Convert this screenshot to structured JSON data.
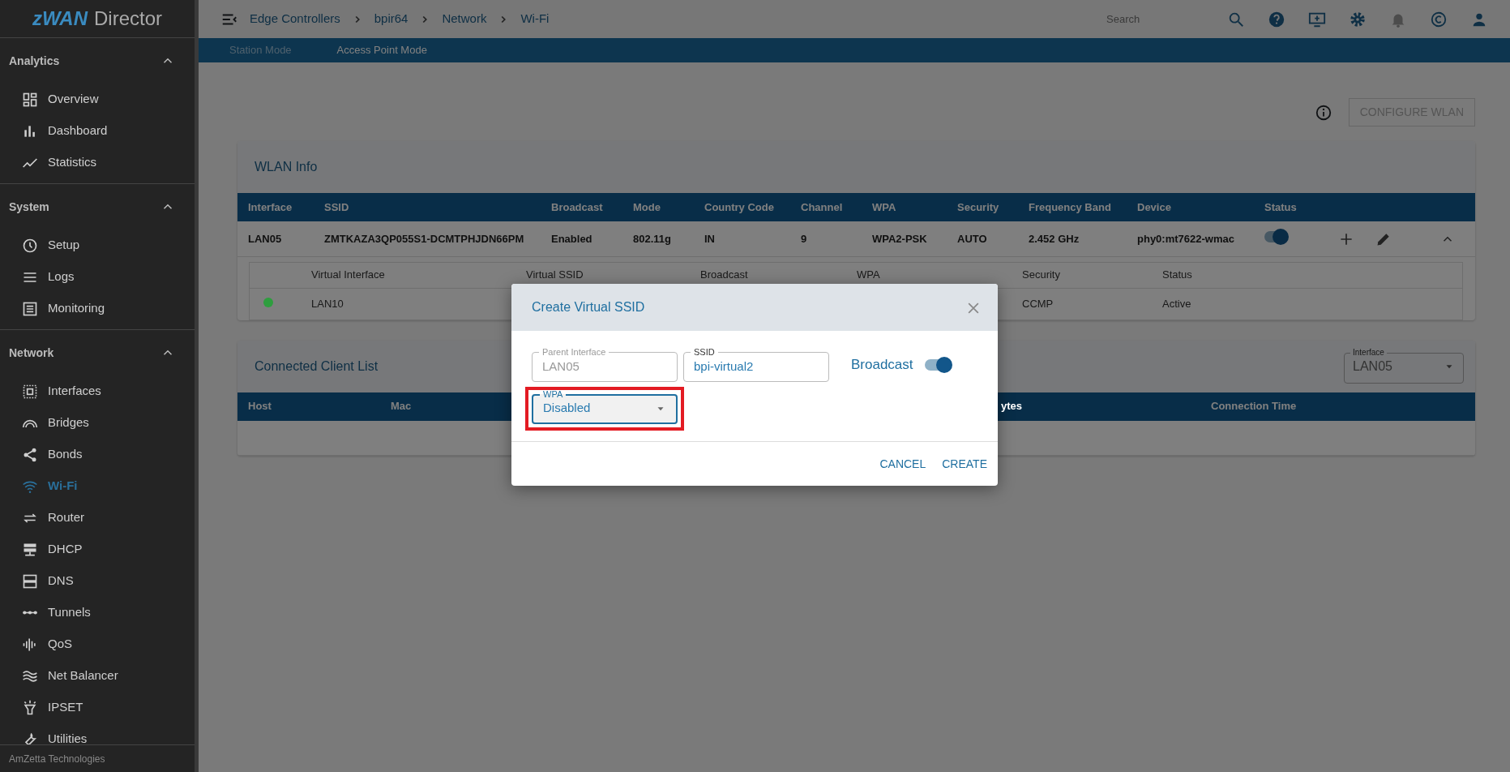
{
  "app": {
    "logo_prefix": "zWAN",
    "logo_suffix": "Director",
    "footer": "AmZetta Technologies"
  },
  "sidebar": {
    "sections": [
      {
        "title": "Analytics",
        "expanded": true,
        "items": [
          {
            "label": "Overview",
            "selected": false
          },
          {
            "label": "Dashboard",
            "selected": false
          },
          {
            "label": "Statistics",
            "selected": false
          }
        ]
      },
      {
        "title": "System",
        "expanded": true,
        "items": [
          {
            "label": "Setup",
            "selected": false
          },
          {
            "label": "Logs",
            "selected": false
          },
          {
            "label": "Monitoring",
            "selected": false
          }
        ]
      },
      {
        "title": "Network",
        "expanded": true,
        "items": [
          {
            "label": "Interfaces",
            "selected": false
          },
          {
            "label": "Bridges",
            "selected": false
          },
          {
            "label": "Bonds",
            "selected": false
          },
          {
            "label": "Wi-Fi",
            "selected": true
          },
          {
            "label": "Router",
            "selected": false
          },
          {
            "label": "DHCP",
            "selected": false
          },
          {
            "label": "DNS",
            "selected": false
          },
          {
            "label": "Tunnels",
            "selected": false
          },
          {
            "label": "QoS",
            "selected": false
          },
          {
            "label": "Net Balancer",
            "selected": false
          },
          {
            "label": "IPSET",
            "selected": false
          },
          {
            "label": "Utilities",
            "selected": false
          }
        ]
      }
    ]
  },
  "topbar": {
    "breadcrumb": [
      "Edge Controllers",
      "bpir64",
      "Network",
      "Wi-Fi"
    ],
    "search": {
      "placeholder": "Search"
    }
  },
  "tabs": [
    {
      "label": "Station Mode",
      "selected": false
    },
    {
      "label": "Access Point Mode",
      "selected": true
    }
  ],
  "configure_button": {
    "label": "CONFIGURE WLAN",
    "disabled": true
  },
  "wlan_card": {
    "title": "WLAN Info",
    "columns": [
      "Interface",
      "SSID",
      "Broadcast",
      "Mode",
      "Country Code",
      "Channel",
      "WPA",
      "Security",
      "Frequency Band",
      "Device",
      "Status"
    ],
    "rows": [
      {
        "cells": [
          "LAN05",
          "ZMTKAZA3QP055S1-DCMTPHJDN66PM",
          "Enabled",
          "802.11g",
          "IN",
          "9",
          "WPA2-PSK",
          "AUTO",
          "2.452 GHz",
          "phy0:mt7622-wmac"
        ],
        "status_on": true,
        "expanded": true
      }
    ],
    "virtual": {
      "columns": [
        "Virtual Interface",
        "Virtual SSID",
        "Broadcast",
        "WPA",
        "Security",
        "Status"
      ],
      "rows": [
        {
          "color": "#2e9e3e",
          "interface": "LAN10",
          "security": "CCMP",
          "status": "Active"
        }
      ]
    }
  },
  "client_card": {
    "title": "Connected Client List",
    "interface_select": {
      "label": "Interface",
      "value": "LAN05"
    },
    "columns": [
      "Host",
      "Mac",
      "ytes",
      "Connection Time"
    ]
  },
  "modal": {
    "title": "Create Virtual SSID",
    "parent_interface": {
      "label": "Parent Interface",
      "value": "LAN05",
      "disabled": true
    },
    "ssid": {
      "label": "SSID",
      "value": "bpi-virtual2"
    },
    "broadcast": {
      "label": "Broadcast",
      "on": true
    },
    "wpa": {
      "label": "WPA",
      "value": "Disabled",
      "highlighted": true
    },
    "buttons": [
      "CANCEL",
      "CREATE"
    ]
  }
}
